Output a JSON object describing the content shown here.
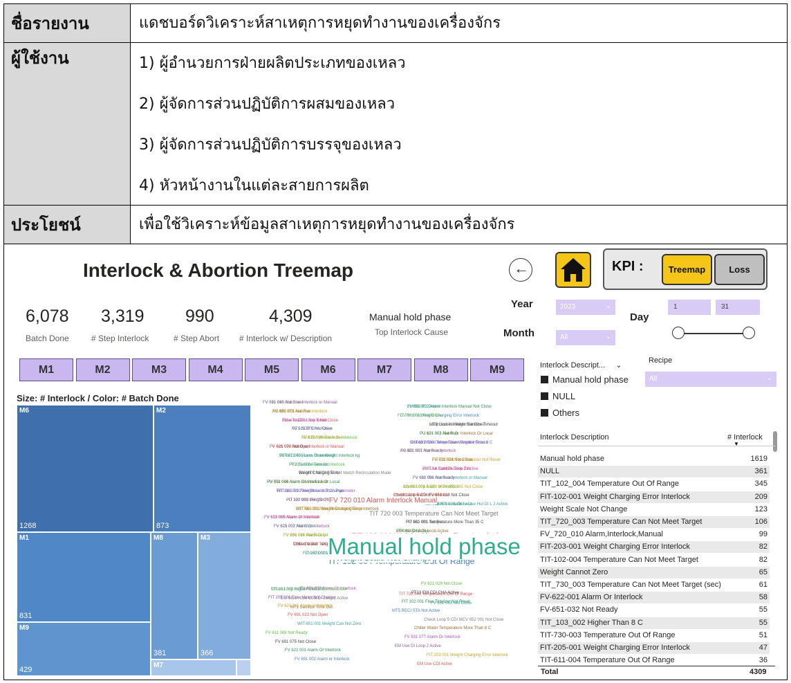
{
  "table": {
    "rows": [
      {
        "label": "ชื่อรายงาน",
        "values": [
          "แดชบอร์ดวิเคราะห์สาเหตุการหยุดทำงานของเครื่องจักร"
        ]
      },
      {
        "label": "ผู้ใช้งาน",
        "values": [
          "1) ผู้อำนวยการฝ่ายผลิตประเภทของเหลว",
          "2) ผู้จัดการส่วนปฏิบัติการผสมของเหลว",
          "3) ผู้จัดการส่วนปฏิบัติการบรรจุของเหลว",
          "4) หัวหน้างานในแต่ละสายการผลิต"
        ]
      },
      {
        "label": "ประโยชน์",
        "values": [
          "เพื่อใช้วิเคราะห์ข้อมูลสาเหตุการหยุดทำงานของเครื่องจักร"
        ]
      }
    ]
  },
  "dashboard": {
    "title": "Interlock & Abortion Treemap",
    "kpi_label": "KPI :",
    "kpi_buttons": [
      "Treemap",
      "Loss"
    ],
    "kpis": [
      {
        "value": "6,078",
        "label": "Batch Done"
      },
      {
        "value": "3,319",
        "label": "# Step Interlock"
      },
      {
        "value": "990",
        "label": "# Step Abort"
      },
      {
        "value": "4,309",
        "label": "# Interlock w/ Description"
      },
      {
        "value": "Manual hold phase",
        "label": "Top Interlock Cause"
      }
    ],
    "year_label": "Year",
    "year_value": "2023",
    "month_label": "Month",
    "month_value": "All",
    "day_label": "Day",
    "day_from": "1",
    "day_to": "31",
    "machines": [
      "M1",
      "M2",
      "M3",
      "M4",
      "M5",
      "M6",
      "M7",
      "M8",
      "M9"
    ],
    "treemap_caption": "Size: # Interlock / Color: # Batch Done",
    "treemap": [
      {
        "name": "M6",
        "value": "1268"
      },
      {
        "name": "M2",
        "value": "873"
      },
      {
        "name": "M1",
        "value": "831"
      },
      {
        "name": "M8",
        "value": "381"
      },
      {
        "name": "M3",
        "value": "366"
      },
      {
        "name": "M9",
        "value": "429"
      },
      {
        "name": "M7",
        "value": ""
      }
    ],
    "wordcloud_big": "Manual hold phase",
    "wordcloud_mid": [
      "TIT 102 004 Temperature Out Of Range",
      "FIT 102 001 Weight Charging Error Interlock",
      "FV 720 010 Alarm Interlock Manual",
      "TIT 720 003 Temperature Can Not Meet Target",
      "NULL",
      "Weight Scale Not Change"
    ],
    "wordcloud_small": [
      "FV 691 045 Alarm or Interlock or Manual",
      "FV 661 002 Alarm Interlock Manual Not Close",
      "FV 691 075 Alarm or Interlock",
      "FIT 730 001 Weight Charging Error Interlock",
      "Valve in CDI Loop 1 Not Close",
      "Loop Sorbitol Valve Not Close",
      "FV 621 075 Not Close",
      "PU 621 001 Alarm Or Interlock Or Local",
      "FV 631 009 Alarm Or Interlock",
      "WIT 692 T001 More Than Weight Interlock",
      "FV 621 070 Not Open",
      "AG 621 001 Alarm or Interlock",
      "WIT 671 001 Less Than Weight Interlock kg",
      "FIT 730 001 Flow Totalizer Not Reset",
      "PT2 Sanitize Timeout",
      "PMT 14 Sanitize Time Out",
      "EM MTF RECI STA Not Match Recirculation Mode",
      "FV 692 001 Alarm or Interlock or Manual",
      "FV 750 019 Alarm Interlock Local",
      "AG 692 001 Alarm or Interlock",
      "WIT 661 001 Weight Less Than Parameter",
      "Check Loop 5 CDI FV 651 018 Not Close",
      "FIT 102 003 Weight Charging Error Interlock",
      "LIT 718 001 Low Or LoLo",
      "FIT 730 001 Flow Meter Not Change",
      "FV 611 051 Not Ready",
      "FV 623 005 Alarm Or Interlock",
      "PU 102 001 Not Run",
      "FV 621 002 Not Close",
      "EM Use Cold DI Loop Active",
      "FV 651 066 Alarm Or Interlock",
      "MT8 CDI CHA Active",
      "Chilled Water Temp More Than 8",
      "PU 102 001 EM CDI RECIR RX Not Run",
      "FIT 102 001 Weight Charging Not Ready",
      "Pig Finished Slowly",
      "TIT 103 002 Higher Than 8 C",
      "TIT 720 003 Temperature Out Of Range",
      "EM Wash Use Cold DI Loop 2 Active",
      "FV 651 063 Not Close",
      "MT1 Sanitize Time Out",
      "FV 621 029 Not Close",
      "FV 621 003 Alarm Or Interlock",
      "PT13 EM CDI CHA Active",
      "FIT 205 001 Flow Meter Not Change",
      "FIT 102 001 Flow Totalizer Not Reset",
      "FV 621 011 Alarm or Interlock",
      "MT5 RECI STA Not Active",
      "FV 691 023 Not Open",
      "Check Loop 5 CDI MCV 652 001 Not Close",
      "WIT 651 001 Weight Can Not Zero",
      "Chiller Water Temperature More Than 8 C",
      "FV 611 086 Not Ready",
      "FV 631 077 Alarm Or Interlock",
      "FV 691 075 Not Close",
      "EM Use DI Loop 2 Active",
      "FV 622 001 Alarm Or Interlock",
      "FIT 203 001 Weight Charging Error Interlock",
      "FV 691 002 Alarm or Interlock",
      "EM Use CDI Active",
      "FV 611 010 Not Close",
      "ZI 653 001 Detect",
      "AG 691 001 Not Run",
      "FCV 661 001 Not Close",
      "Flow Totalizer Not Reset",
      "MT9 Loss in Weight Sanitize Timeout",
      "MT1 SOB CHA Active",
      "PU 101 002 Not Run",
      "MT6 EM WASH Active",
      "Chilled Water Temperature Greater Than 8 C",
      "FV 605 009 Alarm or Interlock or Manual",
      "FV 651 S57 Not Ready",
      "FV 621 045 Alarm Or Interlock",
      "FV 611 024 Not Close",
      "FV 621 006 Alarm Or Interlock",
      "EM Use Cold DI Loop 2 Active",
      "Weight Charging Error",
      "FV 611 094 Not Ready",
      "PU 611 004 Alarm Or Interlock Or Local",
      "Check Loop 5 CDI MCV 653 001 Not Close",
      "FIT 210 001 Flow Meter Not Change",
      "FV 691 014 Alarm or Interlock",
      "PU 102 009 EM CDI RECIR L4 Not Run",
      "EM Wash And Sanitize Use Hot DI L 2 Active",
      "WIT 661 001 Weight Charging Error Interlock",
      "FIT 101 001 Flow Totalizer Not Reset",
      "FV 611 010 Alarm or Interlock",
      "FIT 661 001 Temperature More Than 35 C",
      "FV 625 007 Alarm Or Interlock",
      "PT4 WASH Active",
      "FV 730 017 Not Ready",
      "FV 631 020 Not Close",
      "TOC 101 005 TOC Meter HiHi Or High",
      "WIT 624 001 Less Weight Interlock",
      "FCV 671 029 Not Ready Or Not Close",
      "FV 691 035 Alarm or Interlock",
      "Check Loop 5 CDI FV 651 002 Not Close"
    ],
    "interlock_filter_label": "Interlock Descript...",
    "recipe_label": "Recipe",
    "recipe_value": "All",
    "legend": [
      "Manual hold phase",
      "NULL",
      "Others"
    ],
    "table_header": {
      "desc": "Interlock Description",
      "count": "# Interlock"
    },
    "table_rows": [
      {
        "desc": "Manual hold phase",
        "count": "1619"
      },
      {
        "desc": "NULL",
        "count": "361"
      },
      {
        "desc": "TIT_102_004 Temperature Out Of Range",
        "count": "345"
      },
      {
        "desc": "FIT-102-001 Weight Charging Error Interlock",
        "count": "209"
      },
      {
        "desc": "Weight Scale Not Change",
        "count": "123"
      },
      {
        "desc": "TIT_720_003 Temperature Can Not Meet Target",
        "count": "106"
      },
      {
        "desc": "FV_720_010 Alarm,Interlock,Manual",
        "count": "99"
      },
      {
        "desc": "FIT-203-001 Weight Charging Error Interlock",
        "count": "82"
      },
      {
        "desc": "TIT-102-004 Temperature Can Not Meet Target",
        "count": "82"
      },
      {
        "desc": "Weight Cannot Zero",
        "count": "65"
      },
      {
        "desc": "TIT_730_003 Temperature Can Not Meet Target (sec)",
        "count": "61"
      },
      {
        "desc": "FV-622-001 Alarm Or Interlock",
        "count": "58"
      },
      {
        "desc": "FV-651-032 Not Ready",
        "count": "55"
      },
      {
        "desc": "TIT_103_002 Higher Than 8 C",
        "count": "55"
      },
      {
        "desc": "TIT-730-003 Temperature Out Of Range",
        "count": "51"
      },
      {
        "desc": "FIT-205-001 Weight Charging Error Interlock",
        "count": "47"
      },
      {
        "desc": "TIT-611-004 Temperature Out Of Range",
        "count": "36"
      }
    ],
    "total_label": "Total",
    "total_value": "4309"
  }
}
